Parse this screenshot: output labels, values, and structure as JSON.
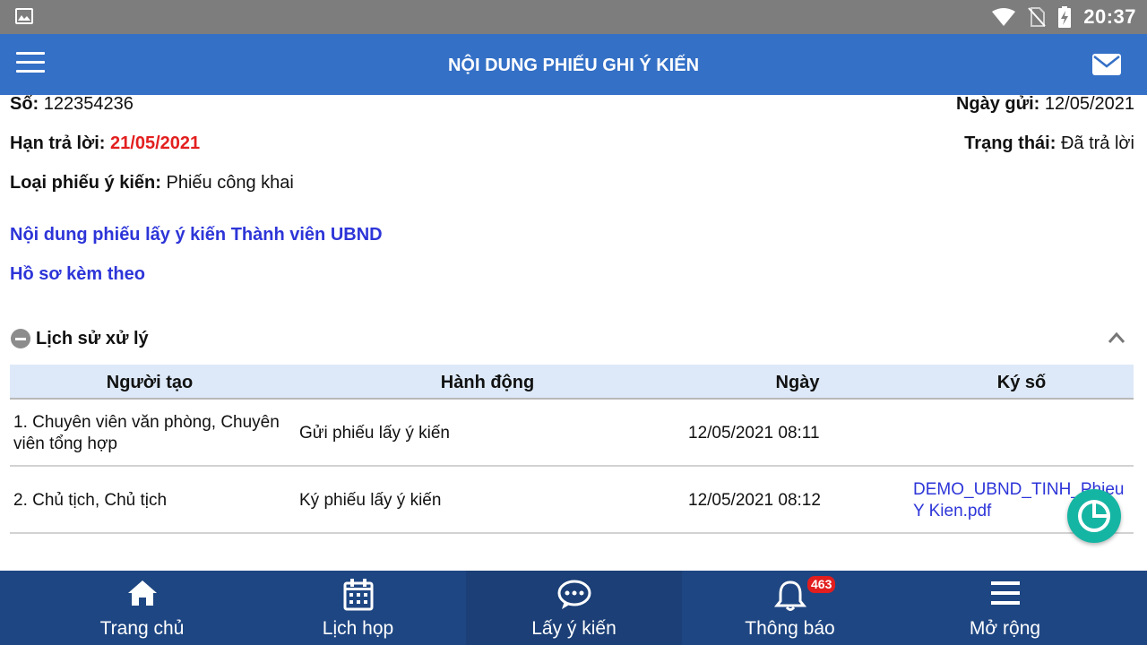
{
  "status_bar": {
    "time": "20:37"
  },
  "header": {
    "title": "NỘI DUNG PHIẾU GHI Ý KIẾN"
  },
  "info": {
    "number_label": "Số:",
    "number_value": "122354236",
    "sent_label": "Ngày gửi:",
    "sent_value": "12/05/2021",
    "deadline_label": "Hạn trả lời:",
    "deadline_value": "21/05/2021",
    "status_label": "Trạng thái:",
    "status_value": "Đã trả lời",
    "type_label": "Loại phiếu ý kiến:",
    "type_value": "Phiếu công khai"
  },
  "links": {
    "content": "Nội dung phiếu lấy ý kiến Thành viên UBND",
    "attachments": "Hồ sơ kèm theo"
  },
  "history": {
    "title": "Lịch sử xử lý",
    "columns": [
      "Người tạo",
      "Hành động",
      "Ngày",
      "Ký số"
    ],
    "rows": [
      {
        "creator": "1. Chuyên viên văn phòng, Chuyên viên tổng hợp",
        "action": "Gửi phiếu lấy ý kiến",
        "date": "12/05/2021 08:11",
        "signature": ""
      },
      {
        "creator": "2. Chủ tịch, Chủ tịch",
        "action": "Ký phiếu lấy ý kiến",
        "date": "12/05/2021 08:12",
        "signature": "DEMO_UBND_TINH_PhieuY Kien.pdf"
      }
    ]
  },
  "bottom_nav": {
    "items": [
      {
        "label": "Trang chủ",
        "icon": "home-icon"
      },
      {
        "label": "Lịch họp",
        "icon": "calendar-icon"
      },
      {
        "label": "Lấy ý kiến",
        "icon": "chat-bubble-icon"
      },
      {
        "label": "Thông báo",
        "icon": "bell-icon",
        "badge": "463"
      },
      {
        "label": "Mở rộng",
        "icon": "menu-icon"
      }
    ],
    "active_index": 2
  },
  "colors": {
    "header_blue": "#3470c6",
    "nav_blue": "#1e4682",
    "link_blue": "#2d35d8",
    "deadline_red": "#e31f1f",
    "fab_teal": "#15b5a3"
  }
}
